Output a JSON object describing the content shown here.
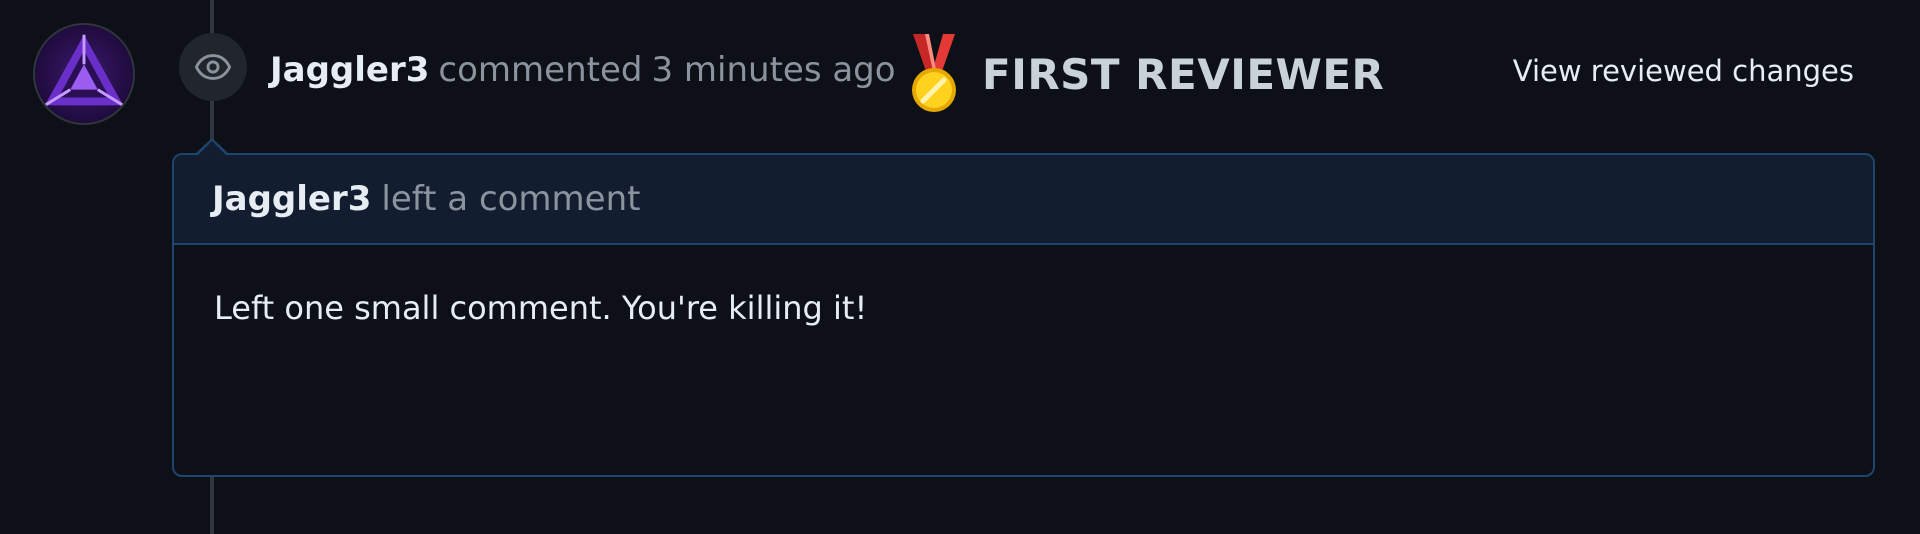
{
  "timeline_item": {
    "author": "Jaggler3",
    "action": "commented",
    "time": "3 minutes ago",
    "badge_icon": "medal-icon",
    "badge_text": "FIRST REVIEWER",
    "view_changes_label": "View reviewed changes"
  },
  "comment": {
    "author": "Jaggler3",
    "action": "left a comment",
    "body": "Left one small comment. You're killing it!"
  },
  "icons": {
    "event_icon": "eye-icon",
    "avatar": "avatar"
  },
  "colors": {
    "background": "#0d1117",
    "border_accent": "#1f4470",
    "header_bg": "#121d2f",
    "text_primary": "#e6edf3",
    "text_muted": "#8b949e",
    "medal_gold": "#f5c518",
    "medal_ribbon": "#d32f2f"
  }
}
